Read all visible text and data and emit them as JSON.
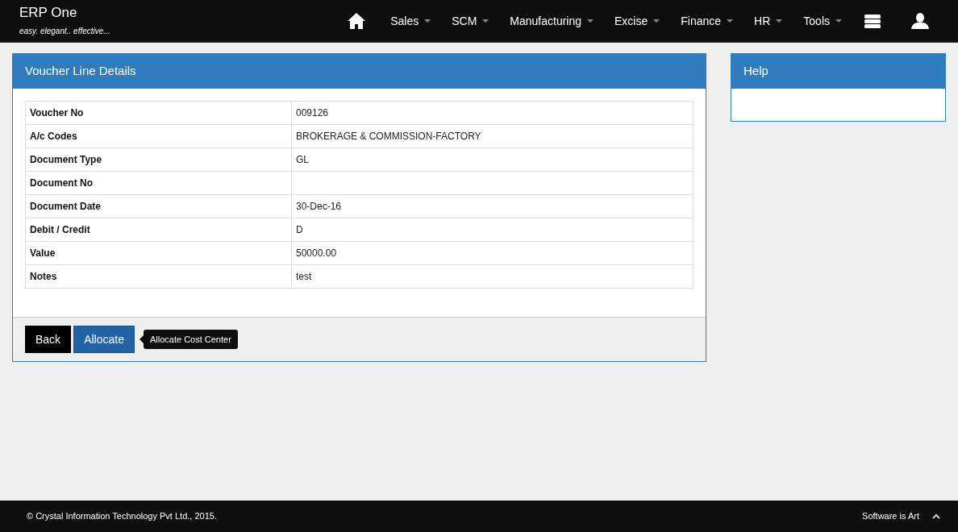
{
  "brand": {
    "title": "ERP One",
    "tagline": "easy. elegant.. effective..."
  },
  "nav": [
    {
      "label": "Sales"
    },
    {
      "label": "SCM"
    },
    {
      "label": "Manufacturing"
    },
    {
      "label": "Excise"
    },
    {
      "label": "Finance"
    },
    {
      "label": "HR"
    },
    {
      "label": "Tools"
    }
  ],
  "panel": {
    "title": "Voucher Line Details",
    "rows": [
      {
        "label": "Voucher No",
        "value": "009126"
      },
      {
        "label": "A/c Codes",
        "value": "BROKERAGE & COMMISSION-FACTORY"
      },
      {
        "label": "Document Type",
        "value": "GL"
      },
      {
        "label": "Document No",
        "value": ""
      },
      {
        "label": "Document Date",
        "value": "30-Dec-16"
      },
      {
        "label": "Debit / Credit",
        "value": "D"
      },
      {
        "label": "Value",
        "value": "50000.00"
      },
      {
        "label": "Notes",
        "value": "test"
      }
    ],
    "buttons": [
      {
        "label": "Back",
        "kind": "dark"
      },
      {
        "label": "Allocate",
        "kind": "primary"
      }
    ],
    "tooltip": "Allocate Cost Center"
  },
  "help": {
    "title": "Help"
  },
  "footer": {
    "copyright": "© Crystal Information Technology Pvt Ltd., 2015.",
    "tagline": "Software is Art"
  }
}
